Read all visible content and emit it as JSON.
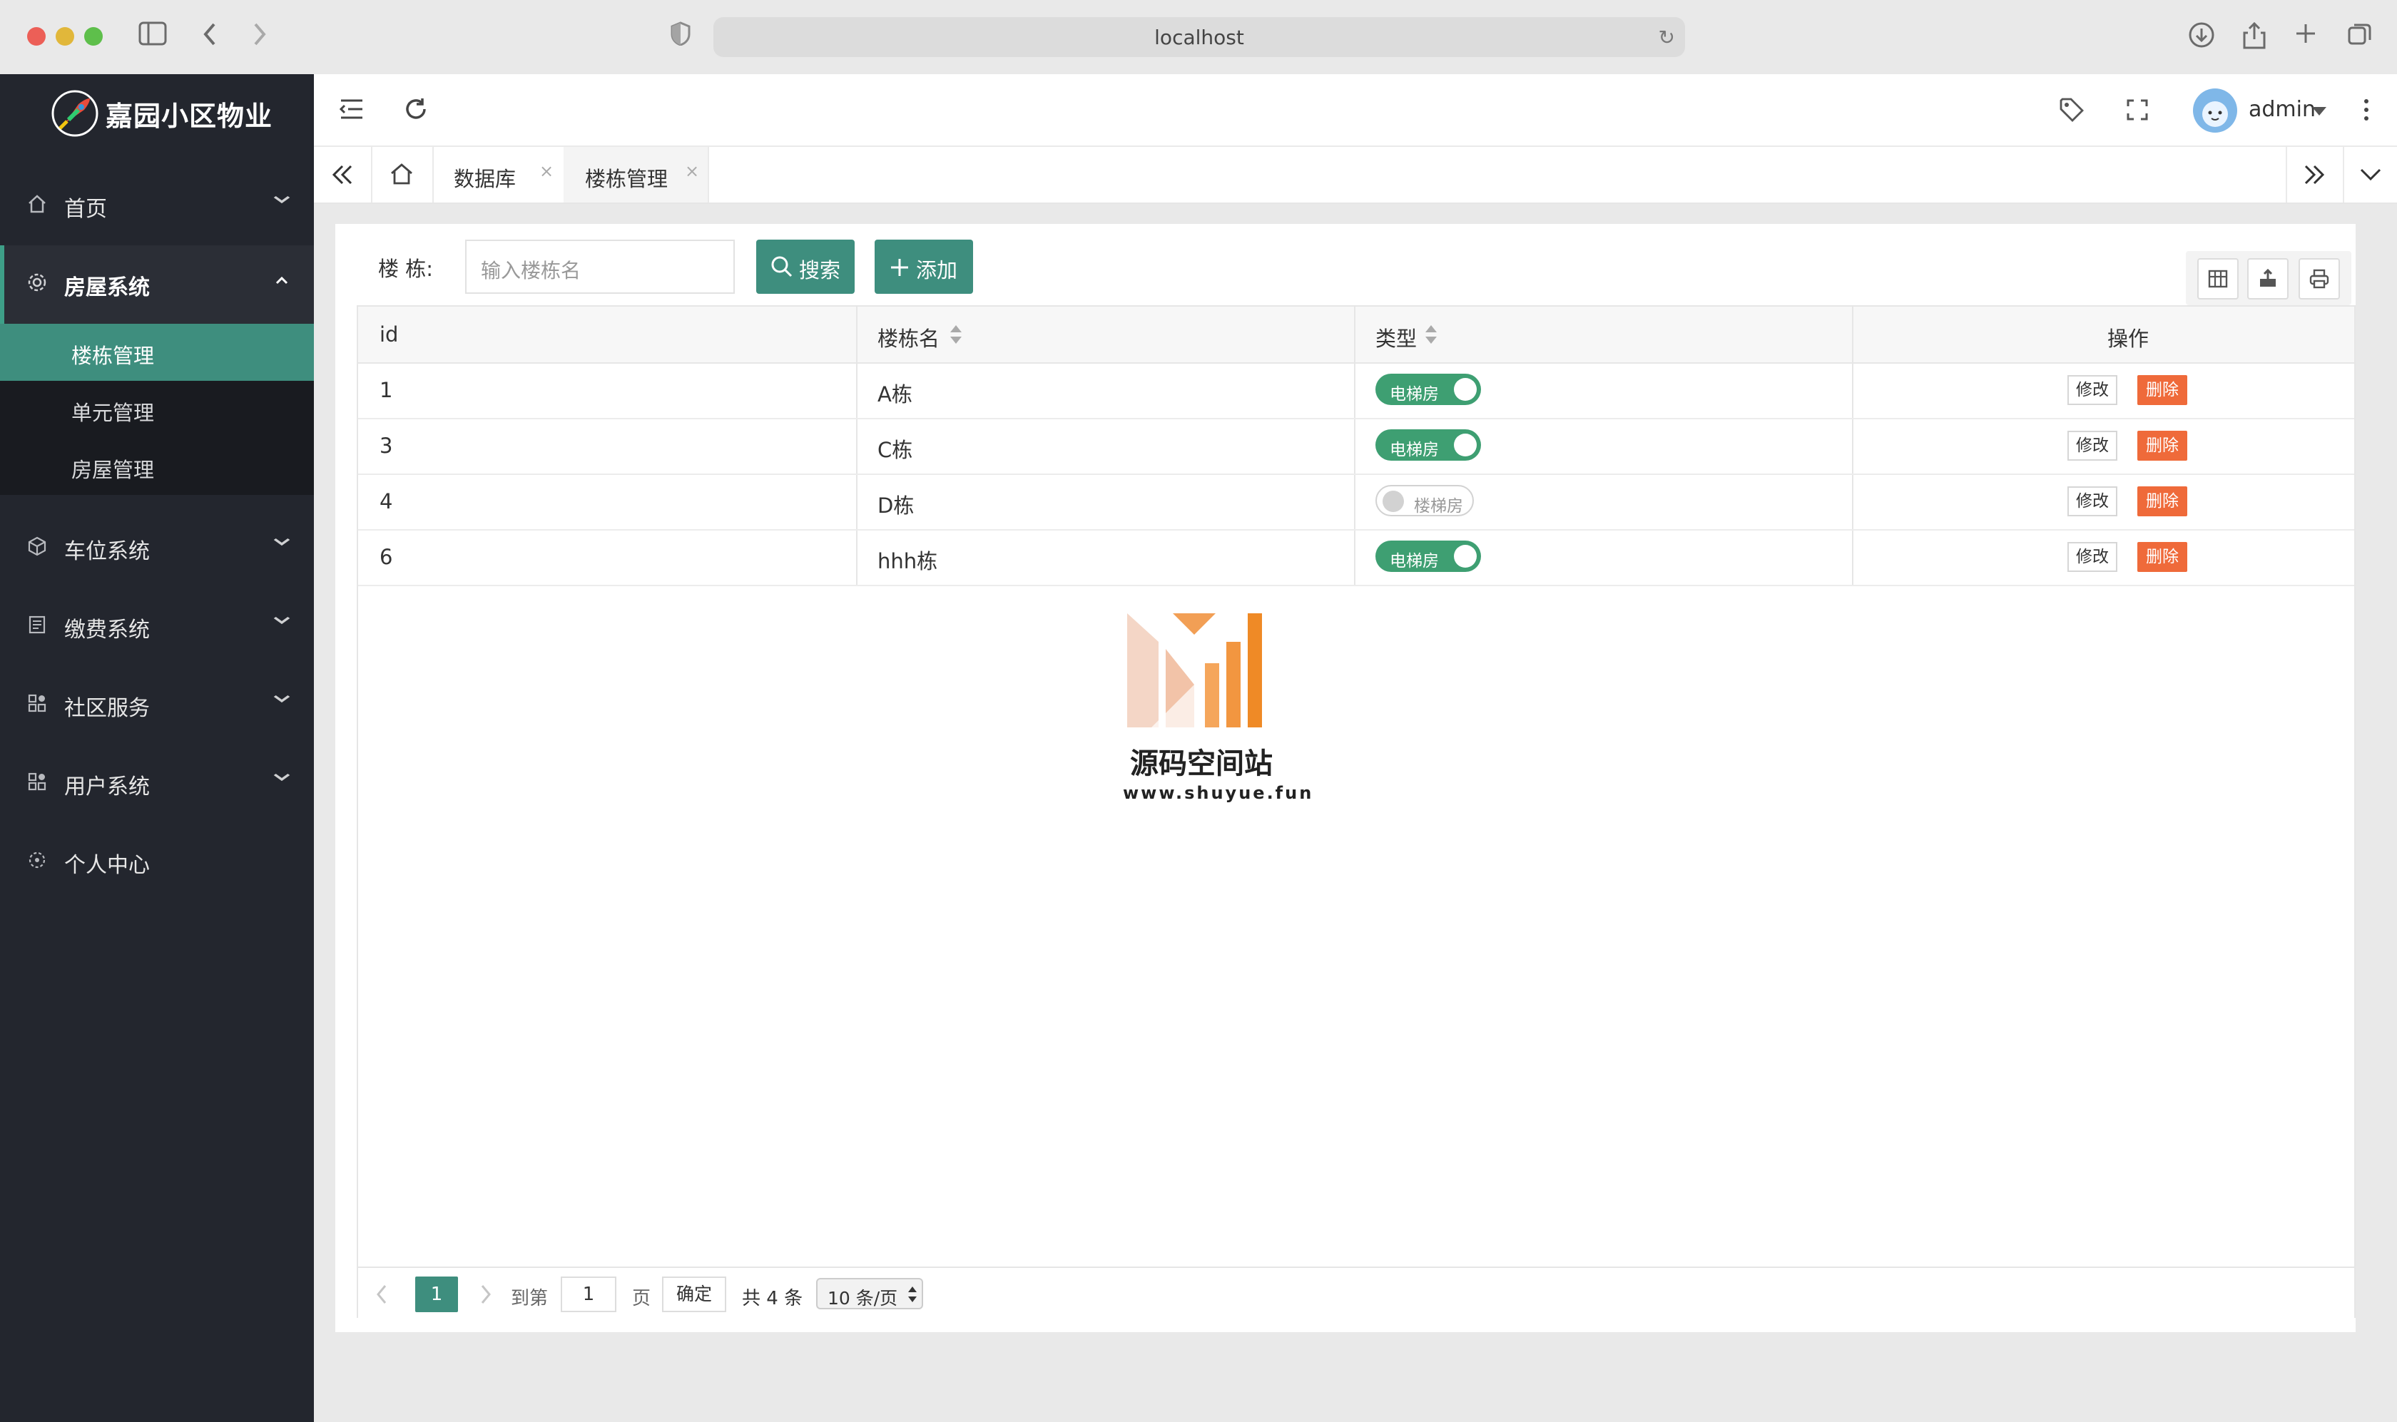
{
  "browser": {
    "url": "localhost"
  },
  "brand": {
    "name": "嘉园小区物业"
  },
  "sidebar": {
    "items": [
      {
        "label": "首页",
        "icon": "home-icon"
      },
      {
        "label": "房屋系统",
        "icon": "gear-icon",
        "expanded": true,
        "children": [
          {
            "label": "楼栋管理",
            "active": true
          },
          {
            "label": "单元管理"
          },
          {
            "label": "房屋管理"
          }
        ]
      },
      {
        "label": "车位系统",
        "icon": "cube-icon"
      },
      {
        "label": "缴费系统",
        "icon": "bill-icon"
      },
      {
        "label": "社区服务",
        "icon": "apps-icon"
      },
      {
        "label": "用户系统",
        "icon": "apps-icon"
      },
      {
        "label": "个人中心",
        "icon": "user-settings-icon"
      }
    ]
  },
  "header": {
    "user": "admin"
  },
  "tabs": [
    {
      "label": "数据库"
    },
    {
      "label": "楼栋管理",
      "active": true
    }
  ],
  "search": {
    "label": "楼 栋:",
    "placeholder": "输入楼栋名",
    "search_button": "搜索",
    "add_button": "添加"
  },
  "table": {
    "columns": [
      "id",
      "楼栋名",
      "类型",
      "操作"
    ],
    "rows": [
      {
        "id": "1",
        "name": "A栋",
        "type": "电梯房",
        "type_on": true
      },
      {
        "id": "3",
        "name": "C栋",
        "type": "电梯房",
        "type_on": true
      },
      {
        "id": "4",
        "name": "D栋",
        "type": "楼梯房",
        "type_on": false
      },
      {
        "id": "6",
        "name": "hhh栋",
        "type": "电梯房",
        "type_on": true
      }
    ],
    "edit_label": "修改",
    "delete_label": "删除"
  },
  "watermark": {
    "title": "源码空间站",
    "url": "www.shuyue.fun"
  },
  "pagination": {
    "current": "1",
    "goto_label": "到第",
    "goto_value": "1",
    "page_unit": "页",
    "confirm_label": "确定",
    "total_label": "共 4 条",
    "page_size": "10 条/页"
  },
  "colors": {
    "accent": "#3e8e7e",
    "sidebar": "#23262e",
    "danger": "#ef6a3a"
  }
}
